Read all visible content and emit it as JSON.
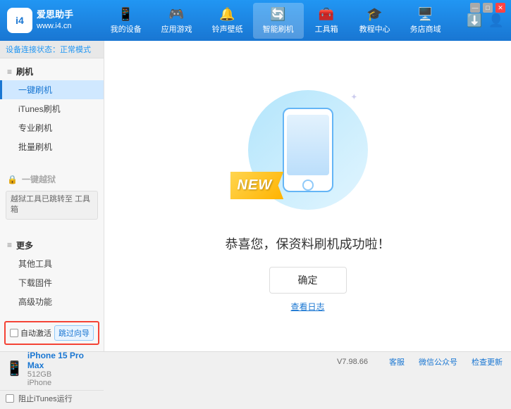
{
  "app": {
    "logo_char": "i4",
    "brand_name": "爱思助手",
    "website": "www.i4.cn"
  },
  "nav": {
    "tabs": [
      {
        "id": "my-device",
        "icon": "📱",
        "label": "我的设备"
      },
      {
        "id": "apps-games",
        "icon": "🕹️",
        "label": "应用游戏"
      },
      {
        "id": "ringtone",
        "icon": "🔔",
        "label": "铃声壁纸"
      },
      {
        "id": "smart-flash",
        "icon": "🔄",
        "label": "智能刷机",
        "active": true
      },
      {
        "id": "toolbox",
        "icon": "🧰",
        "label": "工具箱"
      },
      {
        "id": "tutorial",
        "icon": "🎓",
        "label": "教程中心"
      },
      {
        "id": "service",
        "icon": "🖥️",
        "label": "务店商域"
      }
    ]
  },
  "window_controls": {
    "min": "—",
    "max": "□",
    "close": "✕"
  },
  "sidebar": {
    "status_label": "设备连接状态：",
    "status_value": "正常模式",
    "section_flash": "刷机",
    "items": [
      {
        "id": "one-key-flash",
        "label": "一键刷机",
        "active": true
      },
      {
        "id": "itunes-flash",
        "label": "iTunes刷机"
      },
      {
        "id": "pro-flash",
        "label": "专业刷机"
      },
      {
        "id": "batch-flash",
        "label": "批量刷机"
      }
    ],
    "section_disabled_label": "一键越狱",
    "disabled_notice": "越狱工具已跳转至\n工具箱",
    "section_more": "更多",
    "more_items": [
      {
        "id": "other-tools",
        "label": "其他工具"
      },
      {
        "id": "download-firmware",
        "label": "下载固件"
      },
      {
        "id": "advanced",
        "label": "高级功能"
      }
    ],
    "auto_activate_label": "自动激活",
    "skip_guide_label": "跳过向导",
    "device": {
      "name": "iPhone 15 Pro Max",
      "storage": "512GB",
      "type": "iPhone"
    },
    "stop_itunes_label": "阻止iTunes运行"
  },
  "content": {
    "success_message": "恭喜您，保资料刷机成功啦！",
    "confirm_button": "确定",
    "log_link": "查看日志",
    "new_badge": "NEW"
  },
  "bottom_bar": {
    "version": "V7.98.66",
    "links": [
      "客服",
      "微信公众号",
      "检查更新"
    ]
  }
}
